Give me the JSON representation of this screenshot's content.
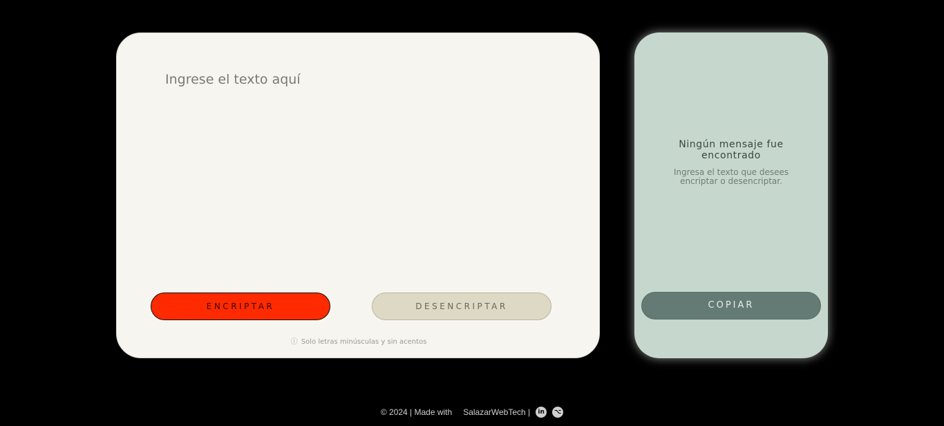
{
  "input": {
    "placeholder": "Ingrese el texto aquí",
    "value": ""
  },
  "buttons": {
    "encrypt_label": "ENCRIPTAR",
    "decrypt_label": "DESENCRIPTAR",
    "copy_label": "COPIAR"
  },
  "hint": {
    "icon": "info-icon",
    "text": "Solo letras minúsculas y sin acentos"
  },
  "output": {
    "title": "Ningún mensaje fue encontrado",
    "description": "Ingresa el texto que desees encriptar o desencriptar."
  },
  "footer": {
    "copyright": "© 2024 | Made with",
    "author": "SalazarWebTech |",
    "icons": [
      "linkedin-icon",
      "github-icon"
    ]
  },
  "colors": {
    "background": "#000000",
    "input_card": "#f6f5ef",
    "output_card": "#c6d8cd",
    "encrypt_button": "#ff2a00",
    "decrypt_button": "#ddd9c4",
    "copy_button": "#647a74"
  }
}
